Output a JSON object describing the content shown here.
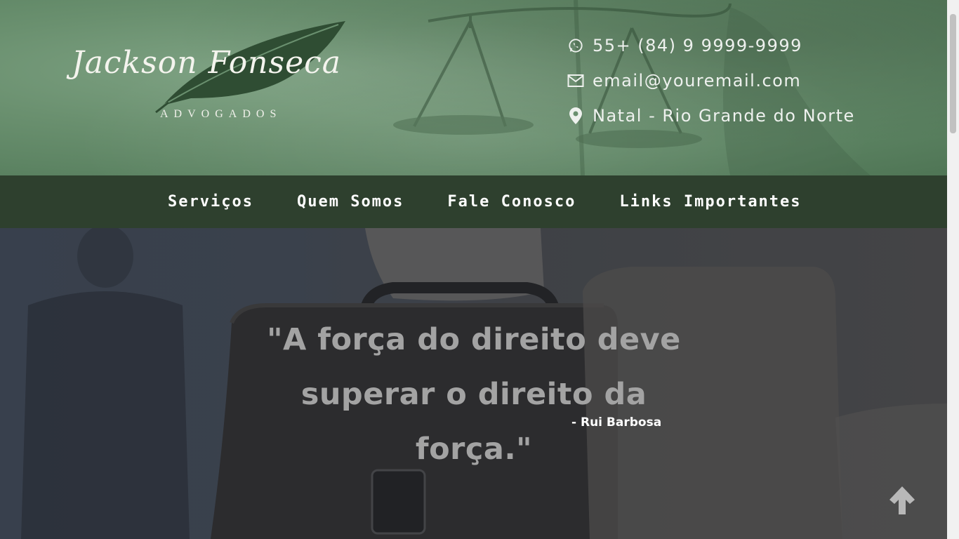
{
  "brand": {
    "name": "Jackson Fonseca",
    "subtitle": "ADVOGADOS"
  },
  "contact": {
    "phone": "55+ (84) 9 9999-9999",
    "email": "email@youremail.com",
    "location": "Natal - Rio Grande do Norte"
  },
  "nav": {
    "items": [
      {
        "label": "Serviços"
      },
      {
        "label": "Quem Somos"
      },
      {
        "label": "Fale Conosco"
      },
      {
        "label": "Links Importantes"
      }
    ]
  },
  "hero": {
    "quote_line1": "\"A força do direito deve",
    "quote_line2": "superar o direito da força.\"",
    "author": "- Rui Barbosa"
  },
  "icons": {
    "phone": "whatsapp-icon",
    "email": "envelope-icon",
    "location": "map-pin-icon",
    "back_to_top": "arrow-up-icon"
  },
  "colors": {
    "header_green": "#6a906f",
    "nav_green": "#2e402e",
    "quote_gray": "#a3a3a3"
  }
}
